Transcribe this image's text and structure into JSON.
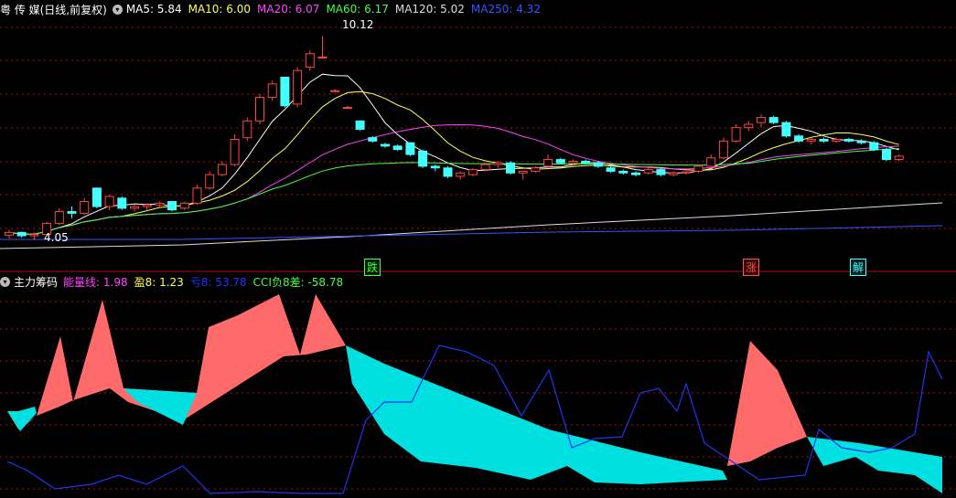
{
  "top_header": {
    "title": "粤 传 媒(日线,前复权)",
    "indicators": [
      {
        "label": "MA5: 5.84",
        "color": "#ffffff"
      },
      {
        "label": "MA10: 6.00",
        "color": "#ffff55"
      },
      {
        "label": "MA20: 6.07",
        "color": "#ff44ff"
      },
      {
        "label": "MA60: 6.17",
        "color": "#44ff44"
      },
      {
        "label": "MA120: 5.02",
        "color": "#dddddd"
      },
      {
        "label": "MA250: 4.32",
        "color": "#3355ff"
      }
    ]
  },
  "bottom_header": {
    "title": "主力筹码",
    "indicators": [
      {
        "label": "能量线: 1.98",
        "color": "#ff44ff"
      },
      {
        "label": "盈8: 1.23",
        "color": "#ffff55"
      },
      {
        "label": "亏8: 53.78",
        "color": "#2233ff"
      },
      {
        "label": "CCI负8差: -58.78",
        "color": "#44ff44"
      }
    ]
  },
  "price_labels": {
    "high": "10.12",
    "low": "4.05"
  },
  "markers": [
    {
      "text": "跌",
      "color": "#44ff44"
    },
    {
      "text": "涨",
      "color": "#ff5555"
    },
    {
      "text": "解",
      "color": "#44ffff"
    }
  ],
  "colors": {
    "up": "#ff4444",
    "down": "#44ffff",
    "grid": "#aa1111"
  },
  "chart_data": {
    "type": "candlestick",
    "candles": [
      [
        4.2,
        4.35,
        4.1,
        4.28
      ],
      [
        4.28,
        4.3,
        4.12,
        4.18
      ],
      [
        4.18,
        4.28,
        4.05,
        4.22
      ],
      [
        4.22,
        4.6,
        4.2,
        4.55
      ],
      [
        4.55,
        5.0,
        4.5,
        4.9
      ],
      [
        4.9,
        5.05,
        4.7,
        4.85
      ],
      [
        4.85,
        5.3,
        4.8,
        5.2
      ],
      [
        5.6,
        5.6,
        5.0,
        5.05
      ],
      [
        5.05,
        5.4,
        4.95,
        5.35
      ],
      [
        5.3,
        5.35,
        4.95,
        5.0
      ],
      [
        5.0,
        5.1,
        4.9,
        5.05
      ],
      [
        5.05,
        5.15,
        4.95,
        5.1
      ],
      [
        5.1,
        5.2,
        5.0,
        5.15
      ],
      [
        5.2,
        5.2,
        4.9,
        4.95
      ],
      [
        5.0,
        5.2,
        4.95,
        5.15
      ],
      [
        5.15,
        5.7,
        5.1,
        5.6
      ],
      [
        5.6,
        6.1,
        5.55,
        6.0
      ],
      [
        6.0,
        6.4,
        5.95,
        6.3
      ],
      [
        6.3,
        7.2,
        6.25,
        7.05
      ],
      [
        7.1,
        7.7,
        7.0,
        7.6
      ],
      [
        7.6,
        8.4,
        7.5,
        8.3
      ],
      [
        8.3,
        8.8,
        8.2,
        8.7
      ],
      [
        8.9,
        8.9,
        8.0,
        8.05
      ],
      [
        8.1,
        9.2,
        8.0,
        9.1
      ],
      [
        9.2,
        9.7,
        9.1,
        9.6
      ],
      [
        9.5,
        10.12,
        9.5,
        9.5
      ],
      [
        8.5,
        8.55,
        8.45,
        8.5
      ],
      [
        8.0,
        8.05,
        7.95,
        8.0
      ],
      [
        7.6,
        7.6,
        7.3,
        7.35
      ],
      [
        7.1,
        7.15,
        6.95,
        7.0
      ],
      [
        6.9,
        6.95,
        6.8,
        6.85
      ],
      [
        6.85,
        6.9,
        6.7,
        6.75
      ],
      [
        6.95,
        6.95,
        6.55,
        6.6
      ],
      [
        6.7,
        6.75,
        6.2,
        6.25
      ],
      [
        6.25,
        6.3,
        6.1,
        6.2
      ],
      [
        6.2,
        6.25,
        5.9,
        5.95
      ],
      [
        5.95,
        6.1,
        5.85,
        6.05
      ],
      [
        6.0,
        6.2,
        5.95,
        6.15
      ],
      [
        6.15,
        6.35,
        6.1,
        6.3
      ],
      [
        6.3,
        6.4,
        6.2,
        6.35
      ],
      [
        6.35,
        6.4,
        6.0,
        6.05
      ],
      [
        6.05,
        6.1,
        5.85,
        6.1
      ],
      [
        6.1,
        6.25,
        6.05,
        6.2
      ],
      [
        6.25,
        6.6,
        6.2,
        6.45
      ],
      [
        6.45,
        6.5,
        6.3,
        6.35
      ],
      [
        6.35,
        6.45,
        6.3,
        6.4
      ],
      [
        6.4,
        6.45,
        6.3,
        6.35
      ],
      [
        6.35,
        6.4,
        6.2,
        6.25
      ],
      [
        6.2,
        6.25,
        6.05,
        6.1
      ],
      [
        6.1,
        6.15,
        6.0,
        6.05
      ],
      [
        6.05,
        6.1,
        5.95,
        6.0
      ],
      [
        6.05,
        6.2,
        6.0,
        6.15
      ],
      [
        6.15,
        6.2,
        5.95,
        6.0
      ],
      [
        6.0,
        6.1,
        5.95,
        6.05
      ],
      [
        6.05,
        6.1,
        6.0,
        6.08
      ],
      [
        6.1,
        6.3,
        6.05,
        6.25
      ],
      [
        6.25,
        6.6,
        6.2,
        6.5
      ],
      [
        6.5,
        7.1,
        6.45,
        7.0
      ],
      [
        7.0,
        7.5,
        6.95,
        7.4
      ],
      [
        7.4,
        7.6,
        7.3,
        7.5
      ],
      [
        7.55,
        7.8,
        7.4,
        7.7
      ],
      [
        7.7,
        7.75,
        7.5,
        7.55
      ],
      [
        7.55,
        7.6,
        7.1,
        7.15
      ],
      [
        7.15,
        7.2,
        6.95,
        7.0
      ],
      [
        7.0,
        7.1,
        6.9,
        7.05
      ],
      [
        7.05,
        7.1,
        6.95,
        7.0
      ],
      [
        7.0,
        7.1,
        6.95,
        7.05
      ],
      [
        7.05,
        7.1,
        6.95,
        7.0
      ],
      [
        7.0,
        7.05,
        6.9,
        6.95
      ],
      [
        6.95,
        7.0,
        6.7,
        6.75
      ],
      [
        6.75,
        6.8,
        6.4,
        6.45
      ],
      [
        6.45,
        6.6,
        6.4,
        6.55
      ]
    ]
  }
}
